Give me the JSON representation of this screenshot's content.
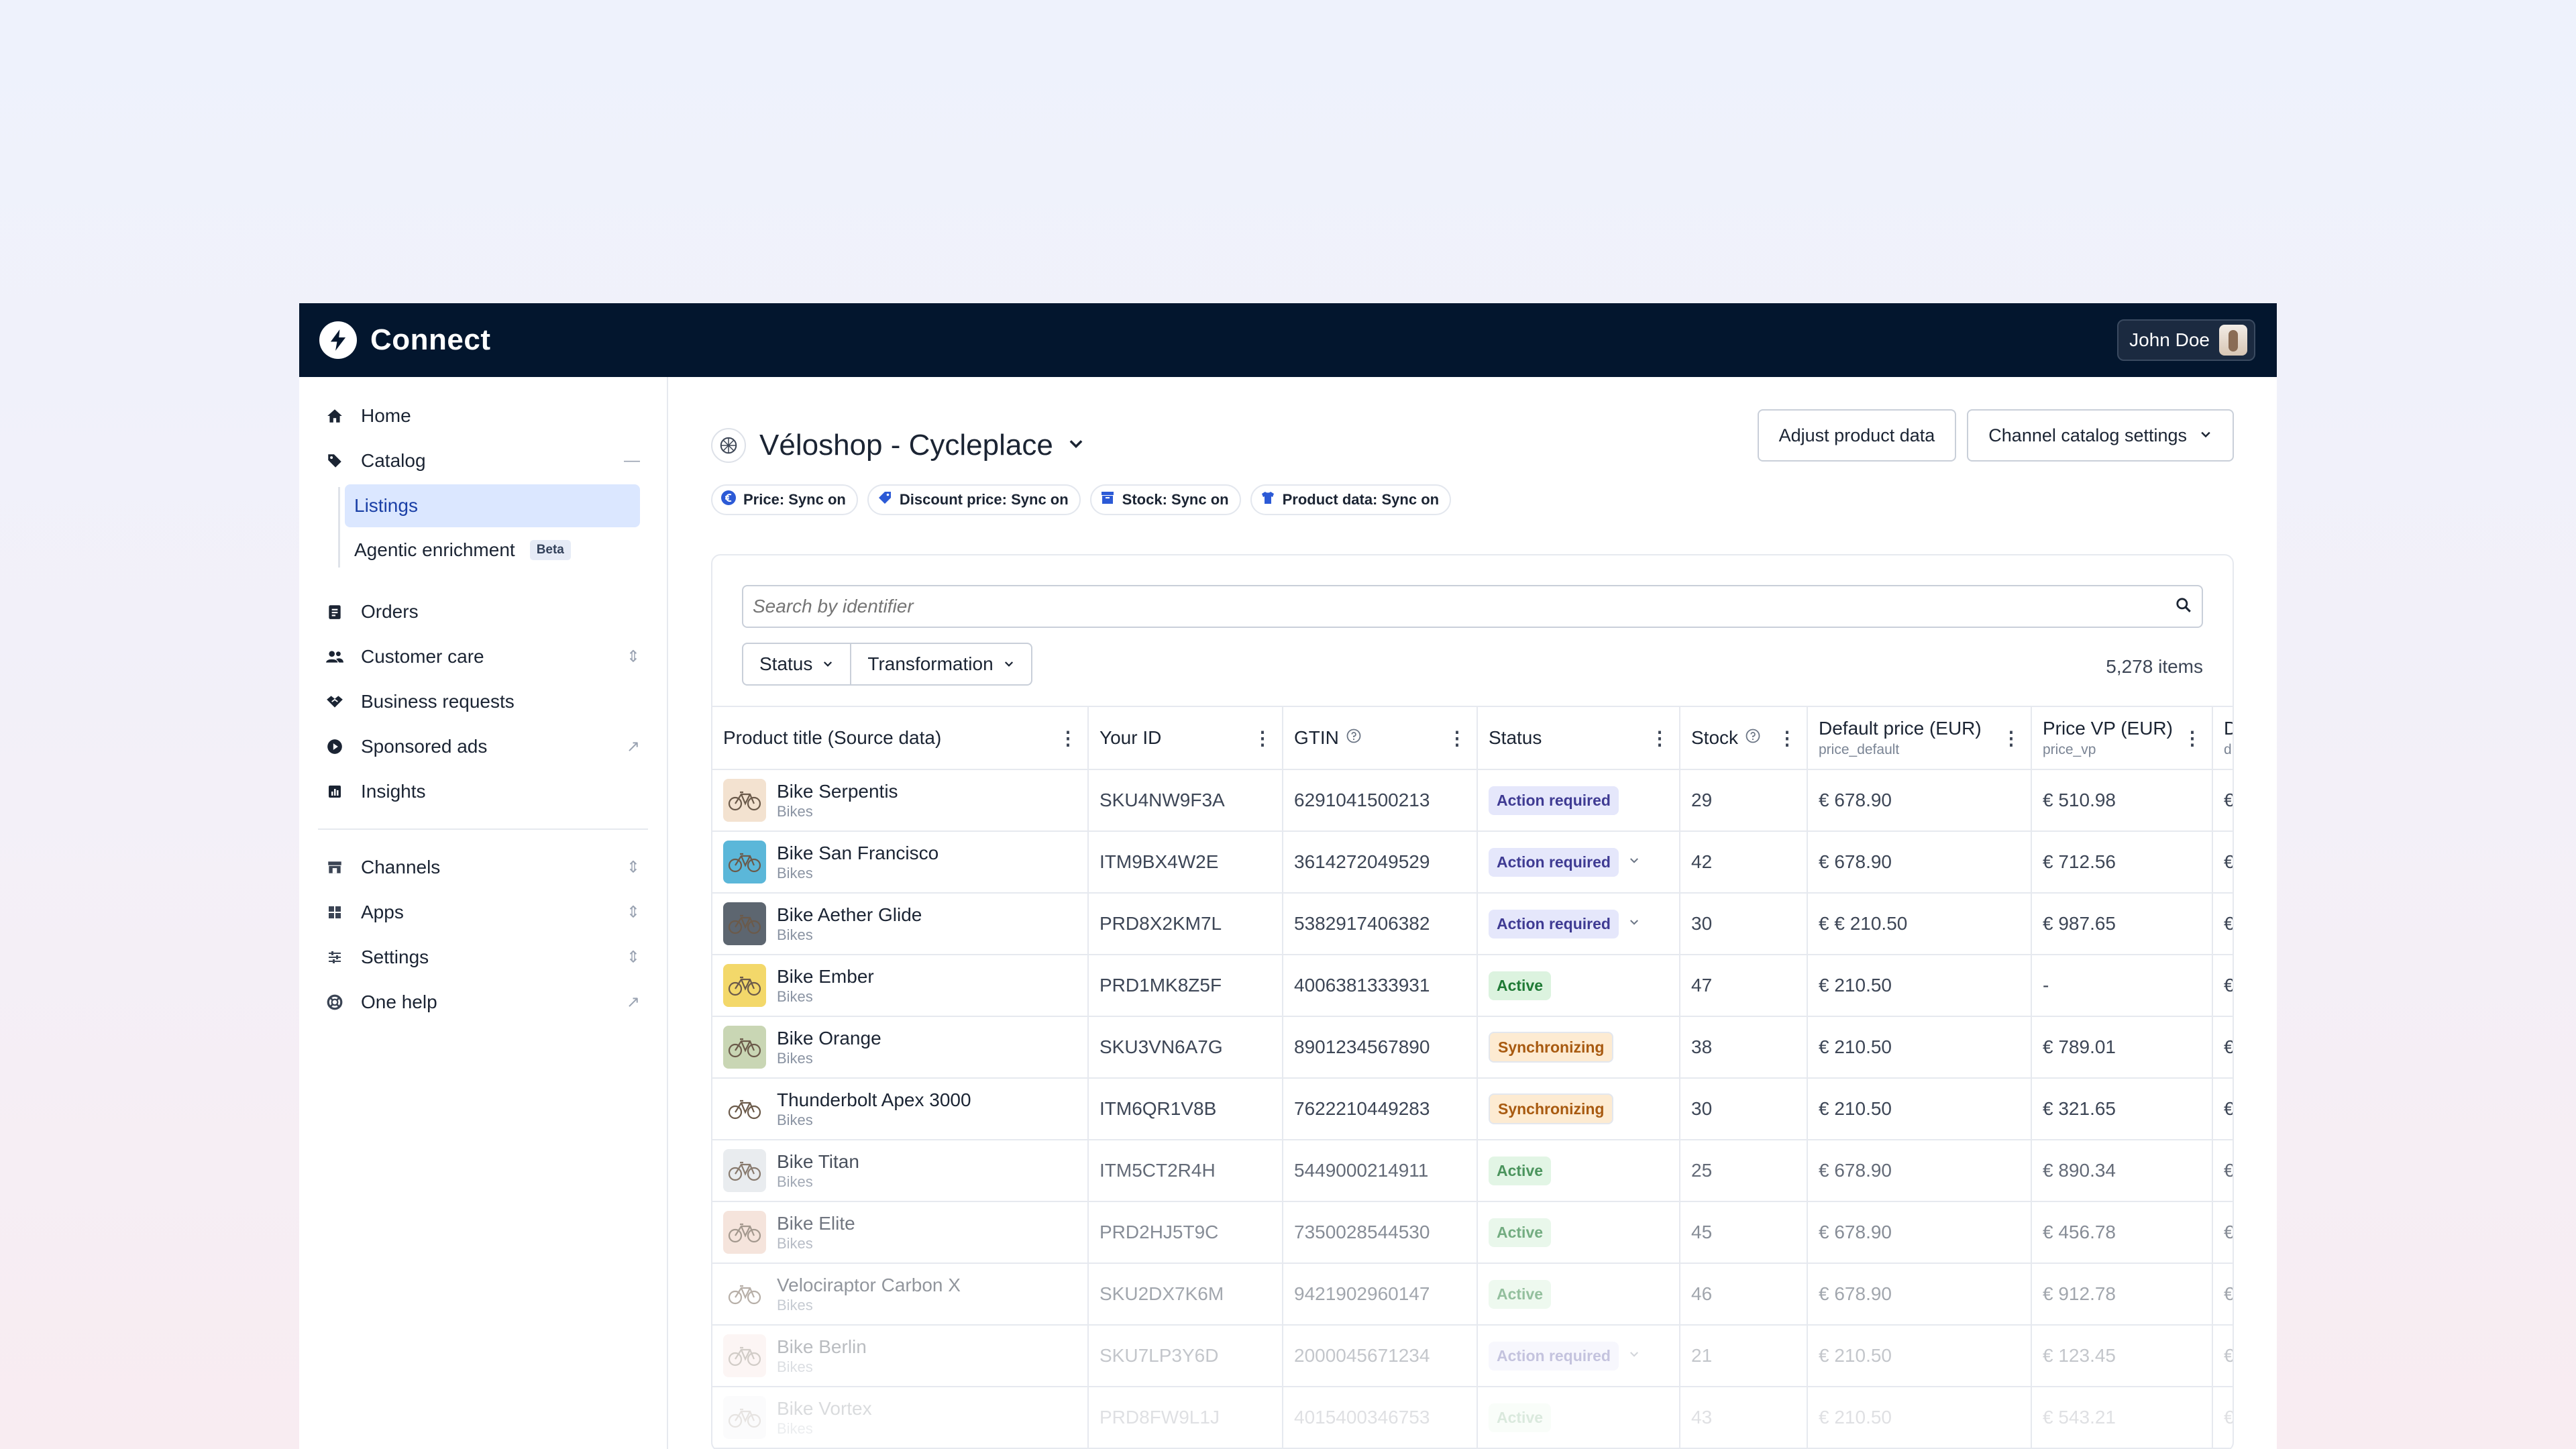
{
  "header": {
    "app_name": "Connect",
    "user_name": "John Doe"
  },
  "sidebar": {
    "items": [
      {
        "label": "Home",
        "icon": "home-icon"
      },
      {
        "label": "Catalog",
        "icon": "tag-icon"
      },
      {
        "label": "Orders",
        "icon": "clipboard-icon"
      },
      {
        "label": "Customer care",
        "icon": "users-icon"
      },
      {
        "label": "Business requests",
        "icon": "handshake-icon"
      },
      {
        "label": "Sponsored ads",
        "icon": "play-icon"
      },
      {
        "label": "Insights",
        "icon": "chart-icon"
      }
    ],
    "catalog_sub": {
      "listings": "Listings",
      "agentic": "Agentic enrichment",
      "beta": "Beta"
    },
    "bottom_items": [
      {
        "label": "Channels",
        "icon": "store-icon"
      },
      {
        "label": "Apps",
        "icon": "apps-icon"
      },
      {
        "label": "Settings",
        "icon": "sliders-icon"
      },
      {
        "label": "One help",
        "icon": "lifebuoy-icon"
      }
    ]
  },
  "page": {
    "title": "Véloshop - Cycleplace",
    "buttons": {
      "adjust": "Adjust product data",
      "channel_settings": "Channel catalog settings"
    },
    "sync_badges": [
      "Price: Sync on",
      "Discount price: Sync on",
      "Stock: Sync on",
      "Product data: Sync on"
    ]
  },
  "search": {
    "placeholder": "Search by identifier"
  },
  "filters": {
    "status": "Status",
    "transformation": "Transformation"
  },
  "item_count": "5,278 items",
  "table": {
    "columns": {
      "product": "Product title (Source data)",
      "your_id": "Your ID",
      "gtin": "GTIN",
      "status": "Status",
      "stock": "Stock",
      "default_price": "Default price (EUR)",
      "default_price_sub": "price_default",
      "price_vp": "Price VP (EUR)",
      "price_vp_sub": "price_vp",
      "disc": "Di",
      "disc_sub": "dis"
    },
    "rows": [
      {
        "name": "Bike Serpentis",
        "cat": "Bikes",
        "id": "SKU4NW9F3A",
        "gtin": "6291041500213",
        "status": "Action required",
        "kind": "action",
        "caret": false,
        "stock": "29",
        "price": "€ 678.90",
        "vp": "€ 510.98",
        "disc": "€"
      },
      {
        "name": "Bike San Francisco",
        "cat": "Bikes",
        "id": "ITM9BX4W2E",
        "gtin": "3614272049529",
        "status": "Action required",
        "kind": "action",
        "caret": true,
        "stock": "42",
        "price": "€ 678.90",
        "vp": "€ 712.56",
        "disc": "€"
      },
      {
        "name": "Bike Aether Glide",
        "cat": "Bikes",
        "id": "PRD8X2KM7L",
        "gtin": "5382917406382",
        "status": "Action required",
        "kind": "action",
        "caret": true,
        "stock": "30",
        "price": "€ € 210.50",
        "vp": "€ 987.65",
        "disc": "€"
      },
      {
        "name": "Bike Ember",
        "cat": "Bikes",
        "id": "PRD1MK8Z5F",
        "gtin": "4006381333931",
        "status": "Active",
        "kind": "active",
        "caret": false,
        "stock": "47",
        "price": "€ 210.50",
        "vp": "-",
        "disc": "€"
      },
      {
        "name": "Bike Orange",
        "cat": "Bikes",
        "id": "SKU3VN6A7G",
        "gtin": "8901234567890",
        "status": "Synchronizing",
        "kind": "sync",
        "caret": false,
        "stock": "38",
        "price": "€ 210.50",
        "vp": "€ 789.01",
        "disc": "€"
      },
      {
        "name": "Thunderbolt Apex 3000",
        "cat": "Bikes",
        "id": "ITM6QR1V8B",
        "gtin": "7622210449283",
        "status": "Synchronizing",
        "kind": "sync",
        "caret": false,
        "stock": "30",
        "price": "€ 210.50",
        "vp": "€ 321.65",
        "disc": "€"
      },
      {
        "name": "Bike Titan",
        "cat": "Bikes",
        "id": "ITM5CT2R4H",
        "gtin": "5449000214911",
        "status": "Active",
        "kind": "active",
        "caret": false,
        "stock": "25",
        "price": "€ 678.90",
        "vp": "€ 890.34",
        "disc": "€"
      },
      {
        "name": "Bike Elite",
        "cat": "Bikes",
        "id": "PRD2HJ5T9C",
        "gtin": "7350028544530",
        "status": "Active",
        "kind": "active",
        "caret": false,
        "stock": "45",
        "price": "€ 678.90",
        "vp": "€ 456.78",
        "disc": "€"
      },
      {
        "name": "Velociraptor Carbon X",
        "cat": "Bikes",
        "id": "SKU2DX7K6M",
        "gtin": "9421902960147",
        "status": "Active",
        "kind": "active",
        "caret": false,
        "stock": "46",
        "price": "€ 678.90",
        "vp": "€ 912.78",
        "disc": "€"
      },
      {
        "name": "Bike Berlin",
        "cat": "Bikes",
        "id": "SKU7LP3Y6D",
        "gtin": "2000045671234",
        "status": "Action required",
        "kind": "action",
        "caret": true,
        "stock": "21",
        "price": "€ 210.50",
        "vp": "€ 123.45",
        "disc": "€"
      },
      {
        "name": "Bike Vortex",
        "cat": "Bikes",
        "id": "PRD8FW9L1J",
        "gtin": "4015400346753",
        "status": "Active",
        "kind": "active",
        "caret": false,
        "stock": "43",
        "price": "€ 210.50",
        "vp": "€ 543.21",
        "disc": "€"
      }
    ]
  },
  "colors": {
    "topbar": "#03162e",
    "accent": "#1a3fa6",
    "active_nav_bg": "#dbe7ff",
    "badge_action": "#e5e7fb",
    "badge_active": "#dcf3df",
    "badge_sync": "#fdebd2"
  }
}
